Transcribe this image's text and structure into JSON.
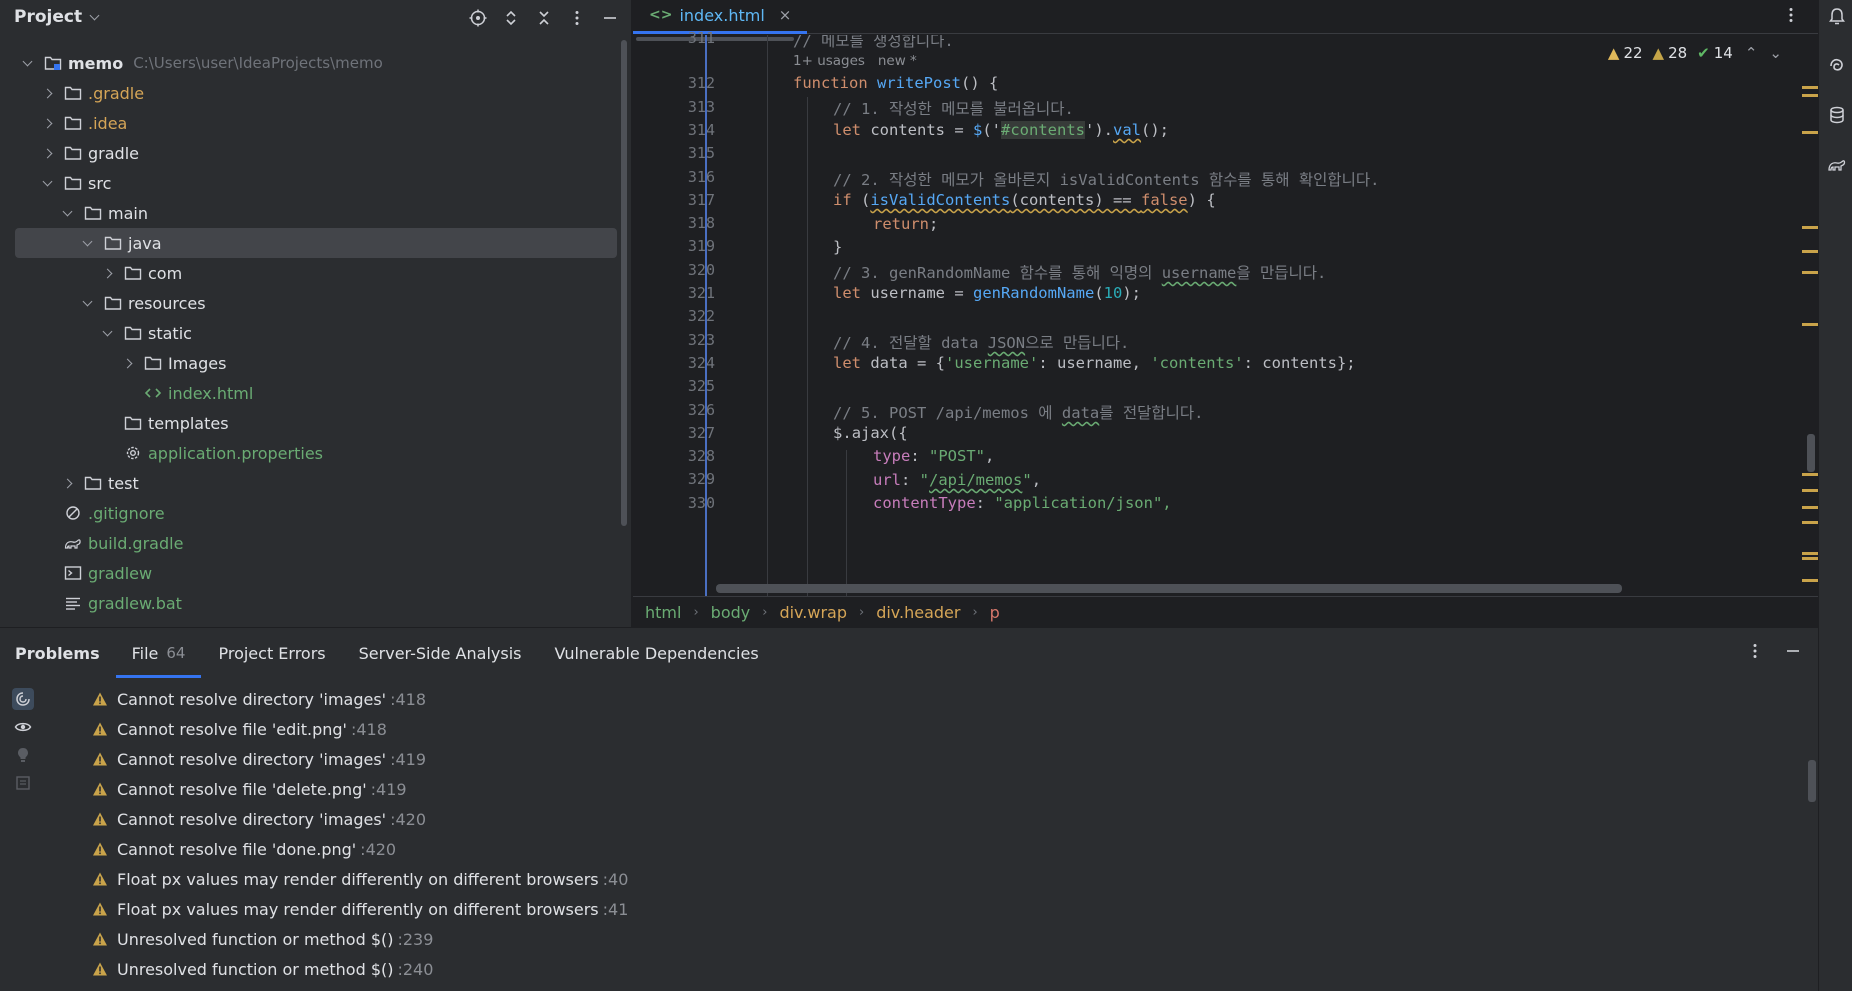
{
  "project": {
    "title": "Project",
    "tree": [
      {
        "label": "memo",
        "path": "C:\\Users\\user\\IdeaProjects\\memo",
        "depth": 0,
        "expanded": true,
        "icon": "module-folder-icon",
        "style": "bold"
      },
      {
        "label": ".gradle",
        "depth": 1,
        "expanded": false,
        "icon": "folder-icon",
        "style": "orange"
      },
      {
        "label": ".idea",
        "depth": 1,
        "expanded": false,
        "icon": "folder-icon",
        "style": "orange"
      },
      {
        "label": "gradle",
        "depth": 1,
        "expanded": false,
        "icon": "folder-icon",
        "style": ""
      },
      {
        "label": "src",
        "depth": 1,
        "expanded": true,
        "icon": "folder-icon",
        "style": ""
      },
      {
        "label": "main",
        "depth": 2,
        "expanded": true,
        "icon": "folder-icon",
        "style": ""
      },
      {
        "label": "java",
        "depth": 3,
        "expanded": true,
        "icon": "source-folder-icon",
        "style": "",
        "selected": true
      },
      {
        "label": "com",
        "depth": 4,
        "expanded": false,
        "icon": "package-icon",
        "style": ""
      },
      {
        "label": "resources",
        "depth": 3,
        "expanded": true,
        "icon": "resources-folder-icon",
        "style": ""
      },
      {
        "label": "static",
        "depth": 4,
        "expanded": true,
        "icon": "folder-icon",
        "style": ""
      },
      {
        "label": "Images",
        "depth": 5,
        "expanded": false,
        "icon": "folder-icon",
        "style": ""
      },
      {
        "label": "index.html",
        "depth": 5,
        "leaf": true,
        "icon": "html-file-icon",
        "style": "green"
      },
      {
        "label": "templates",
        "depth": 4,
        "leaf": true,
        "icon": "folder-icon",
        "style": ""
      },
      {
        "label": "application.properties",
        "depth": 4,
        "leaf": true,
        "icon": "settings-file-icon",
        "style": "green"
      },
      {
        "label": "test",
        "depth": 2,
        "expanded": false,
        "icon": "folder-icon",
        "style": ""
      },
      {
        "label": ".gitignore",
        "depth": 1,
        "leaf": true,
        "icon": "ignore-file-icon",
        "style": "green"
      },
      {
        "label": "build.gradle",
        "depth": 1,
        "leaf": true,
        "icon": "gradle-file-icon",
        "style": "green"
      },
      {
        "label": "gradlew",
        "depth": 1,
        "leaf": true,
        "icon": "terminal-file-icon",
        "style": "green"
      },
      {
        "label": "gradlew.bat",
        "depth": 1,
        "leaf": true,
        "icon": "text-file-icon",
        "style": "green"
      }
    ]
  },
  "editor": {
    "tab": {
      "icon": "<>",
      "label": "index.html",
      "close": "×"
    },
    "inspections": {
      "warnings": "22",
      "weak_warnings": "28",
      "ok": "14"
    },
    "inlay": {
      "usages": "1+ usages",
      "author": "new *"
    },
    "line_numbers": [
      "311",
      "312",
      "313",
      "314",
      "315",
      "316",
      "317",
      "318",
      "319",
      "320",
      "321",
      "322",
      "323",
      "324",
      "325",
      "326",
      "327",
      "328",
      "329",
      "330"
    ],
    "lines": {
      "l311": "// 메모를 생성합니다.",
      "l312_kw": "function",
      "l312_fn": "writePost",
      "l312_rest": "() {",
      "l313": "// 1. 작성한 메모를 불러옵니다.",
      "l314_kw": "let",
      "l314_a": " contents = ",
      "l314_fn": "$",
      "l314_b": "('",
      "l314_str": "#contents",
      "l314_c": "').",
      "l314_fn2": "val",
      "l314_d": "();",
      "l316": "// 2. 작성한 메모가 올바른지 isValidContents 함수를 통해 확인합니다.",
      "l317_kw": "if",
      "l317_a": " (",
      "l317_fn": "isValidContents",
      "l317_b": "(contents) == ",
      "l317_kw2": "false",
      "l317_c": ") {",
      "l318_kw": "return",
      "l318_a": ";",
      "l319": "}",
      "l320_a": "// 3. genRandomName 함수를 통해 익명의 ",
      "l320_u": "username",
      "l320_b": "을 만듭니다.",
      "l321_kw": "let",
      "l321_a": " username = ",
      "l321_fn": "genRandomName",
      "l321_b": "(",
      "l321_num": "10",
      "l321_c": ");",
      "l323_a": "// 4. 전달할 data ",
      "l323_u": "JSON",
      "l323_b": "으로 만듭니다.",
      "l324_kw": "let",
      "l324_a": " data = {",
      "l324_s1": "'username'",
      "l324_b": ": username, ",
      "l324_s2": "'contents'",
      "l324_c": ": contents};",
      "l326_a": "// 5. POST /api/memos 에 ",
      "l326_u": "data",
      "l326_b": "를 전달합니다.",
      "l327_fn": "$",
      "l327_a": ".",
      "l327_fn2": "ajax",
      "l327_b": "({",
      "l328_p": "type",
      "l328_a": ": ",
      "l328_s": "\"POST\"",
      "l328_b": ",",
      "l329_p": "url",
      "l329_a": ": ",
      "l329_s1": "\"",
      "l329_su": "/api/memos",
      "l329_s2": "\"",
      "l329_b": ",",
      "l330_p": "contentType",
      "l330_a": ": ",
      "l330_s": "\"application/json\","
    },
    "breadcrumbs": [
      "html",
      "body",
      "div.wrap",
      "div.header",
      "p"
    ]
  },
  "problems": {
    "title": "Problems",
    "tabs": [
      {
        "label": "File",
        "count": "64",
        "active": true
      },
      {
        "label": "Project Errors"
      },
      {
        "label": "Server-Side Analysis"
      },
      {
        "label": "Vulnerable Dependencies"
      }
    ],
    "items": [
      {
        "text": "Cannot resolve directory 'images'",
        "line": ":418"
      },
      {
        "text": "Cannot resolve file 'edit.png'",
        "line": ":418"
      },
      {
        "text": "Cannot resolve directory 'images'",
        "line": ":419"
      },
      {
        "text": "Cannot resolve file 'delete.png'",
        "line": ":419"
      },
      {
        "text": "Cannot resolve directory 'images'",
        "line": ":420"
      },
      {
        "text": "Cannot resolve file 'done.png'",
        "line": ":420"
      },
      {
        "text": "Float px values may render differently on different browsers",
        "line": ":40"
      },
      {
        "text": "Float px values may render differently on different browsers",
        "line": ":41"
      },
      {
        "text": "Unresolved function or method $()",
        "line": ":239"
      },
      {
        "text": "Unresolved function or method $()",
        "line": ":240"
      }
    ]
  },
  "colors": {
    "accent": "#3574f0",
    "warning": "#e0b85a",
    "string": "#6aab73",
    "keyword": "#cf8e6d",
    "function": "#56a8f5"
  }
}
